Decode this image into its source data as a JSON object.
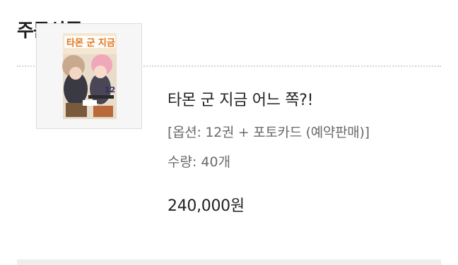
{
  "order_section": {
    "title": "주문상품"
  },
  "item": {
    "title": "타몬 군 지금 어느 쪽?!",
    "option": "[옵션: 12권 + 포토카드 (예약판매)]",
    "quantity": "수량: 40개",
    "price": "240,000원",
    "thumbnail_icon": "book-cover-image",
    "thumbnail_cover_text": "타몬 군 지금",
    "thumbnail_volume": "12"
  }
}
